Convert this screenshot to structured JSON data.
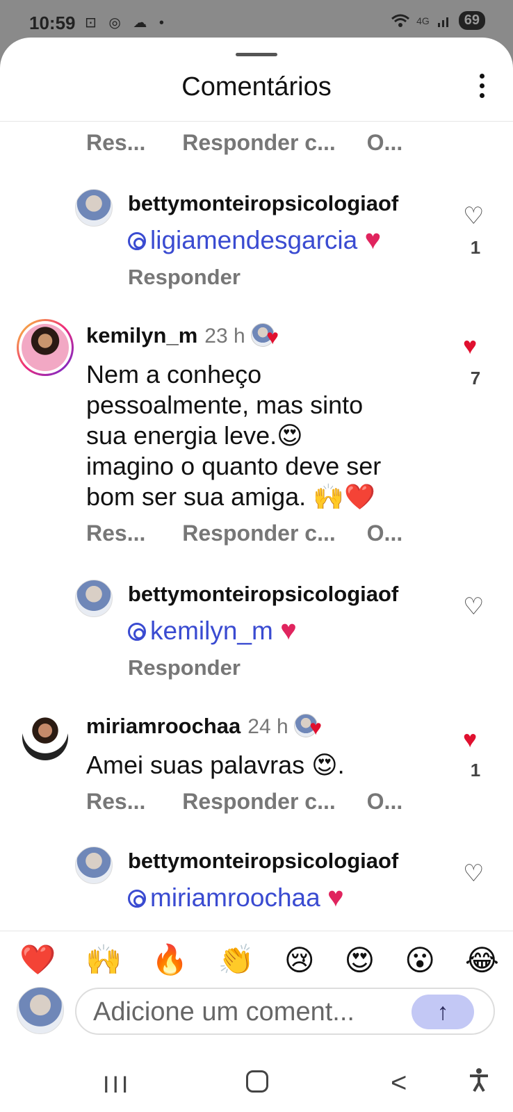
{
  "status": {
    "time": "10:59",
    "left_icons": "⊡ ◎ ☁ •",
    "network": "4G",
    "battery": "69"
  },
  "header": {
    "title": "Comentários"
  },
  "actions": {
    "reply_short": "Res...",
    "reply_to": "Responder c...",
    "more": "O..."
  },
  "comments": [
    {
      "username": "bettymonteiropsicologiaof",
      "mention": "ligiamendesgarcia",
      "heart": "♥",
      "reply": "Responder",
      "likes": "1"
    },
    {
      "username": "kemilyn_m",
      "time": "23 h",
      "text_lines": [
        "Nem a conheço",
        "pessoalmente, mas sinto",
        "sua energia leve.😍",
        "imagino o quanto deve ser",
        "bom ser sua amiga. 🙌❤️"
      ],
      "likes": "7"
    },
    {
      "username": "bettymonteiropsicologiaof",
      "mention": "kemilyn_m",
      "heart": "♥",
      "reply": "Responder"
    },
    {
      "username": "miriamroochaa",
      "time": "24 h",
      "text": "Amei suas palavras 😍.",
      "likes": "1"
    },
    {
      "username": "bettymonteiropsicologiaof",
      "mention": "miriamroochaa",
      "heart": "♥"
    }
  ],
  "emoji_bar": [
    "❤️",
    "🙌",
    "🔥",
    "👏",
    "😢",
    "😍",
    "😮",
    "😂"
  ],
  "composer": {
    "placeholder": "Adicione um coment...",
    "send": "↑"
  },
  "navbar": {
    "recent": "III",
    "back": "<",
    "accessibility": "✝"
  },
  "colors": {
    "mention": "#3a4bd1",
    "like": "#e0102f",
    "send_button": "#c3c8f5"
  }
}
